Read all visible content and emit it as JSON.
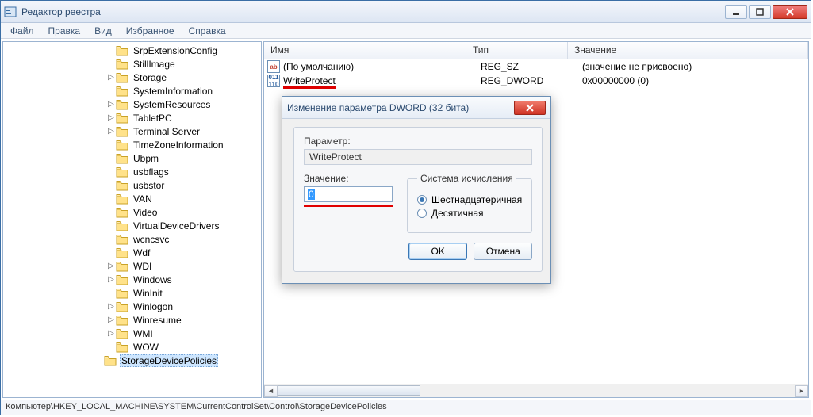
{
  "window": {
    "title": "Редактор реестра"
  },
  "menu": {
    "file": "Файл",
    "edit": "Правка",
    "view": "Вид",
    "favorites": "Избранное",
    "help": "Справка"
  },
  "tree": {
    "items": [
      "SrpExtensionConfig",
      "StillImage",
      "Storage",
      "SystemInformation",
      "SystemResources",
      "TabletPC",
      "Terminal Server",
      "TimeZoneInformation",
      "Ubpm",
      "usbflags",
      "usbstor",
      "VAN",
      "Video",
      "VirtualDeviceDrivers",
      "wcncsvc",
      "Wdf",
      "WDI",
      "Windows",
      "WinInit",
      "Winlogon",
      "Winresume",
      "WMI",
      "WOW",
      "StorageDevicePolicies"
    ],
    "selected_index": 23,
    "expandable": [
      2,
      4,
      5,
      6,
      16,
      17,
      19,
      20,
      21
    ]
  },
  "list": {
    "headers": {
      "name": "Имя",
      "type": "Тип",
      "value": "Значение"
    },
    "rows": [
      {
        "icon": "ab",
        "name": "(По умолчанию)",
        "type": "REG_SZ",
        "value": "(значение не присвоено)"
      },
      {
        "icon": "dw",
        "name": "WriteProtect",
        "type": "REG_DWORD",
        "value": "0x00000000 (0)"
      }
    ]
  },
  "dialog": {
    "title": "Изменение параметра DWORD (32 бита)",
    "param_label": "Параметр:",
    "param_value": "WriteProtect",
    "value_label": "Значение:",
    "value_input": "0",
    "base_group": "Система исчисления",
    "base_hex": "Шестнадцатеричная",
    "base_dec": "Десятичная",
    "ok": "OK",
    "cancel": "Отмена"
  },
  "statusbar": "Компьютер\\HKEY_LOCAL_MACHINE\\SYSTEM\\CurrentControlSet\\Control\\StorageDevicePolicies"
}
